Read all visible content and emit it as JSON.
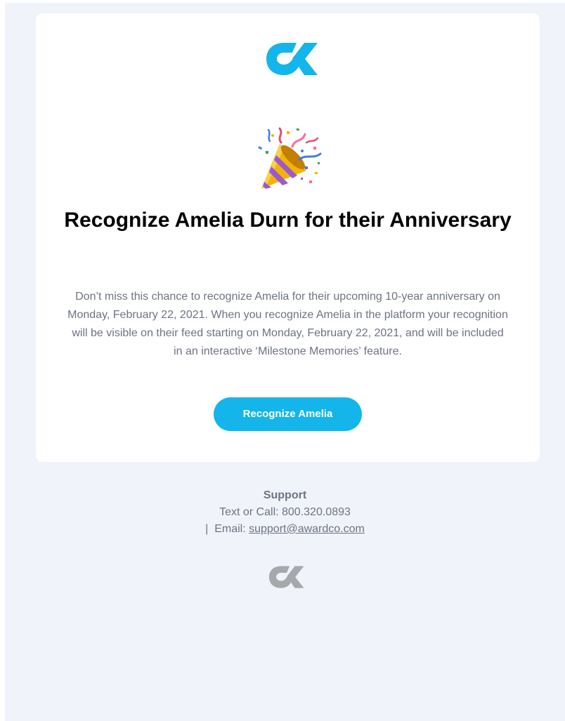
{
  "email": {
    "headline": "Recognize Amelia Durn for their Anniversary",
    "body": "Don’t miss this chance to recognize Amelia for their upcoming 10-year anniversary on Monday, February 22, 2021. When you recognize Amelia in the platform your recognition will be visible on their feed starting on Monday, February 22, 2021, and will be included in an interactive ‘Milestone Memories’ feature.",
    "cta_label": "Recognize Amelia",
    "hero_icon": "party-popper-icon",
    "logo_icon": "awardco-logo-icon"
  },
  "footer": {
    "support_title": "Support",
    "phone_line": "Text or Call: 800.320.0893",
    "email_prefix": "|  Email: ",
    "email_link": "support@awardco.com"
  },
  "colors": {
    "brand_blue": "#13b5ea",
    "background": "#f1f3fa",
    "text_muted": "#6d7382",
    "logo_gray": "#a6a8ab"
  }
}
